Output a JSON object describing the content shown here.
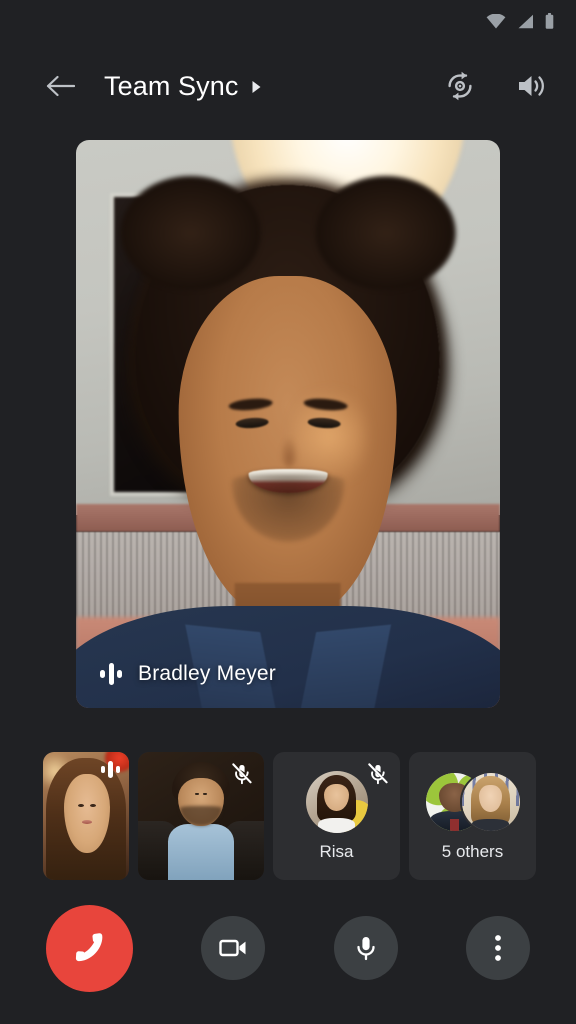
{
  "app": {
    "name": "video-call",
    "background_color": "#202124",
    "tile_background_color": "#2d2e31",
    "control_background_color": "#3c4043",
    "end_call_color": "#E8453C",
    "text_color": "#ffffff"
  },
  "status_bar": {
    "icons": [
      "wifi-icon",
      "cellular-signal-icon",
      "battery-icon"
    ],
    "icon_color": "#9aa0a6"
  },
  "app_bar": {
    "back_label": "Back",
    "back_icon": "arrow-left-icon",
    "title": "Team Sync",
    "title_caret_icon": "caret-right-icon",
    "actions": [
      {
        "name": "switch-camera",
        "icon": "camera-flip-icon",
        "label": "Switch camera"
      },
      {
        "name": "speaker",
        "icon": "speaker-volume-icon",
        "label": "Speaker"
      }
    ]
  },
  "main_speaker": {
    "name": "Bradley Meyer",
    "speaking_icon": "audio-waveform-icon",
    "muted": false
  },
  "participants_strip": [
    {
      "id": "p1",
      "type": "video",
      "name": "",
      "speaking": true,
      "muted": false,
      "badge_icon": "audio-waveform-icon"
    },
    {
      "id": "p2",
      "type": "video",
      "name": "",
      "speaking": false,
      "muted": true,
      "badge_icon": "mic-off-icon"
    },
    {
      "id": "p3",
      "type": "avatar",
      "name": "Risa",
      "speaking": false,
      "muted": true,
      "badge_icon": "mic-off-icon"
    },
    {
      "id": "p4",
      "type": "avatar-group",
      "name": "5 others",
      "speaking": false,
      "muted": false,
      "badge_icon": ""
    }
  ],
  "controls": [
    {
      "name": "end-call",
      "icon": "call-end-icon",
      "label": "End call",
      "style": "end"
    },
    {
      "name": "camera",
      "icon": "video-camera-icon",
      "label": "Camera",
      "style": "round"
    },
    {
      "name": "microphone",
      "icon": "microphone-icon",
      "label": "Microphone",
      "style": "round"
    },
    {
      "name": "more-options",
      "icon": "more-vertical-icon",
      "label": "More options",
      "style": "round"
    }
  ]
}
